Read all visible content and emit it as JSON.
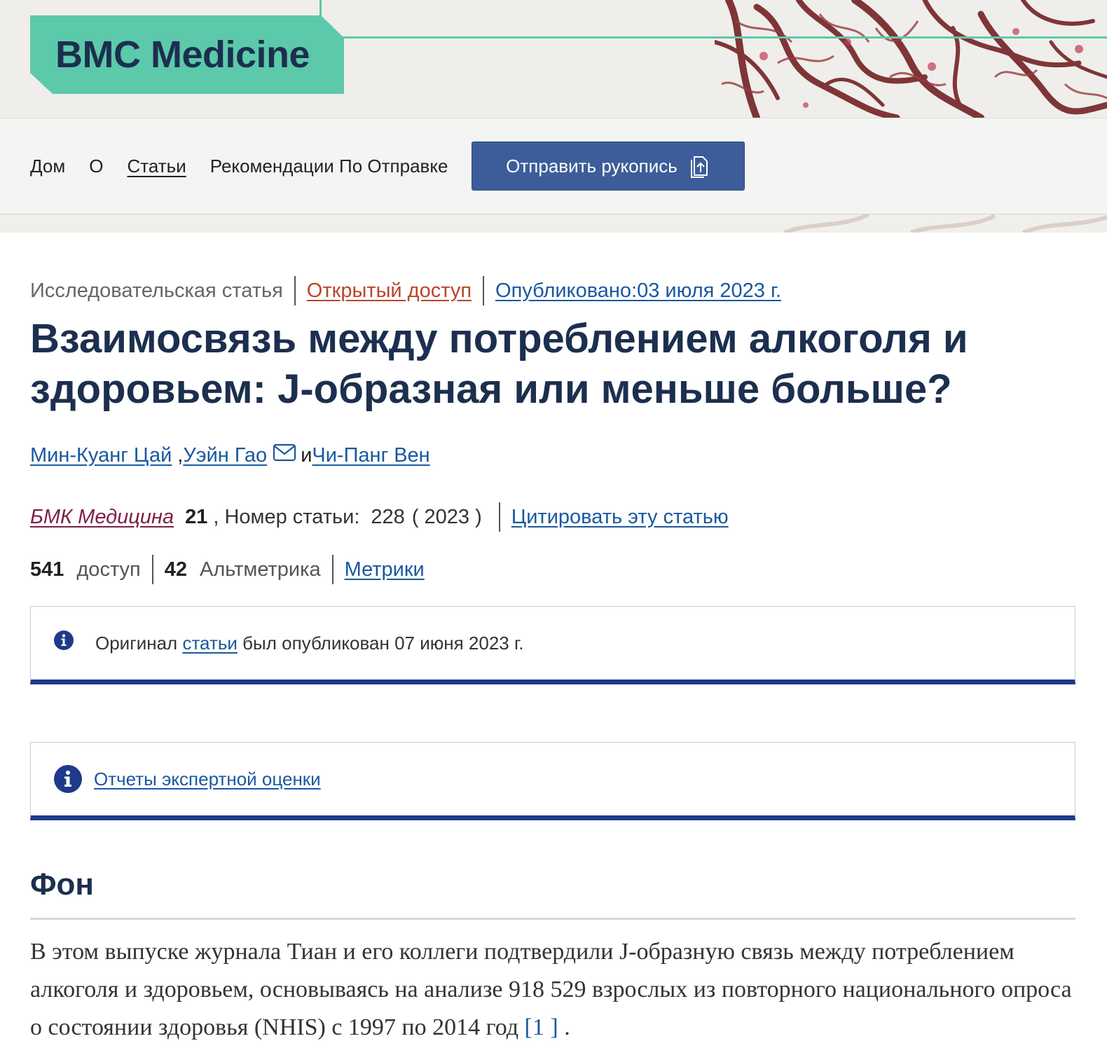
{
  "header": {
    "logo_text": "BMC Medicine"
  },
  "nav": {
    "items": [
      {
        "label": "Дом"
      },
      {
        "label": "О"
      },
      {
        "label": "Статьи"
      },
      {
        "label": "Рекомендации По Отправке"
      }
    ],
    "submit_label": "Отправить рукопись"
  },
  "article": {
    "type": "Исследовательская статья",
    "access": "Открытый доступ",
    "published": "Опубликовано:03 июля 2023 г.",
    "title": "Взаимосвязь между потреблением алкоголя и здоровьем: J-образная или меньше больше?",
    "authors": [
      "Мин-Куанг Цай",
      "Уэйн Гао",
      "Чи-Панг Вен"
    ],
    "author_sep_comma": ",",
    "author_sep_and": "и",
    "journal": "БМК Медицина",
    "volume": "21",
    "article_number_label": ", Номер статьи:",
    "article_number": "228",
    "year": "( 2023 )",
    "cite_label": "Цитировать эту статью",
    "accesses_count": "541",
    "accesses_label": "доступ",
    "altmetric_count": "42",
    "altmetric_label": "Альтметрика",
    "metrics_label": "Метрики"
  },
  "notices": {
    "original_prefix": "Оригинал",
    "original_link": "статьи",
    "original_suffix": "был опубликован 07 июня 2023 г.",
    "peer_review_link": "Отчеты экспертной оценки"
  },
  "section": {
    "title": "Фон",
    "paragraph": "В этом выпуске журнала Тиан и его коллеги подтвердили J-образную связь между потреблением алкоголя и здоровьем, основываясь на анализе 918 529 взрослых из повторного национального опроса о состоянии здоровья (NHIS) с 1997 по 2014 год",
    "ref_open": "[1",
    "ref_close": "]",
    "end": "."
  },
  "colors": {
    "brand_teal": "#5cc9ab",
    "brand_navy": "#1c2f4e",
    "link_blue": "#1a58a0",
    "open_access": "#b9462a",
    "journal_link": "#7d1f45",
    "button_blue": "#3c5d9a",
    "notice_bar": "#1f3a8a"
  },
  "icons": {
    "submit": "upload-document-icon",
    "author_email": "envelope-icon",
    "notice": "info-icon"
  }
}
